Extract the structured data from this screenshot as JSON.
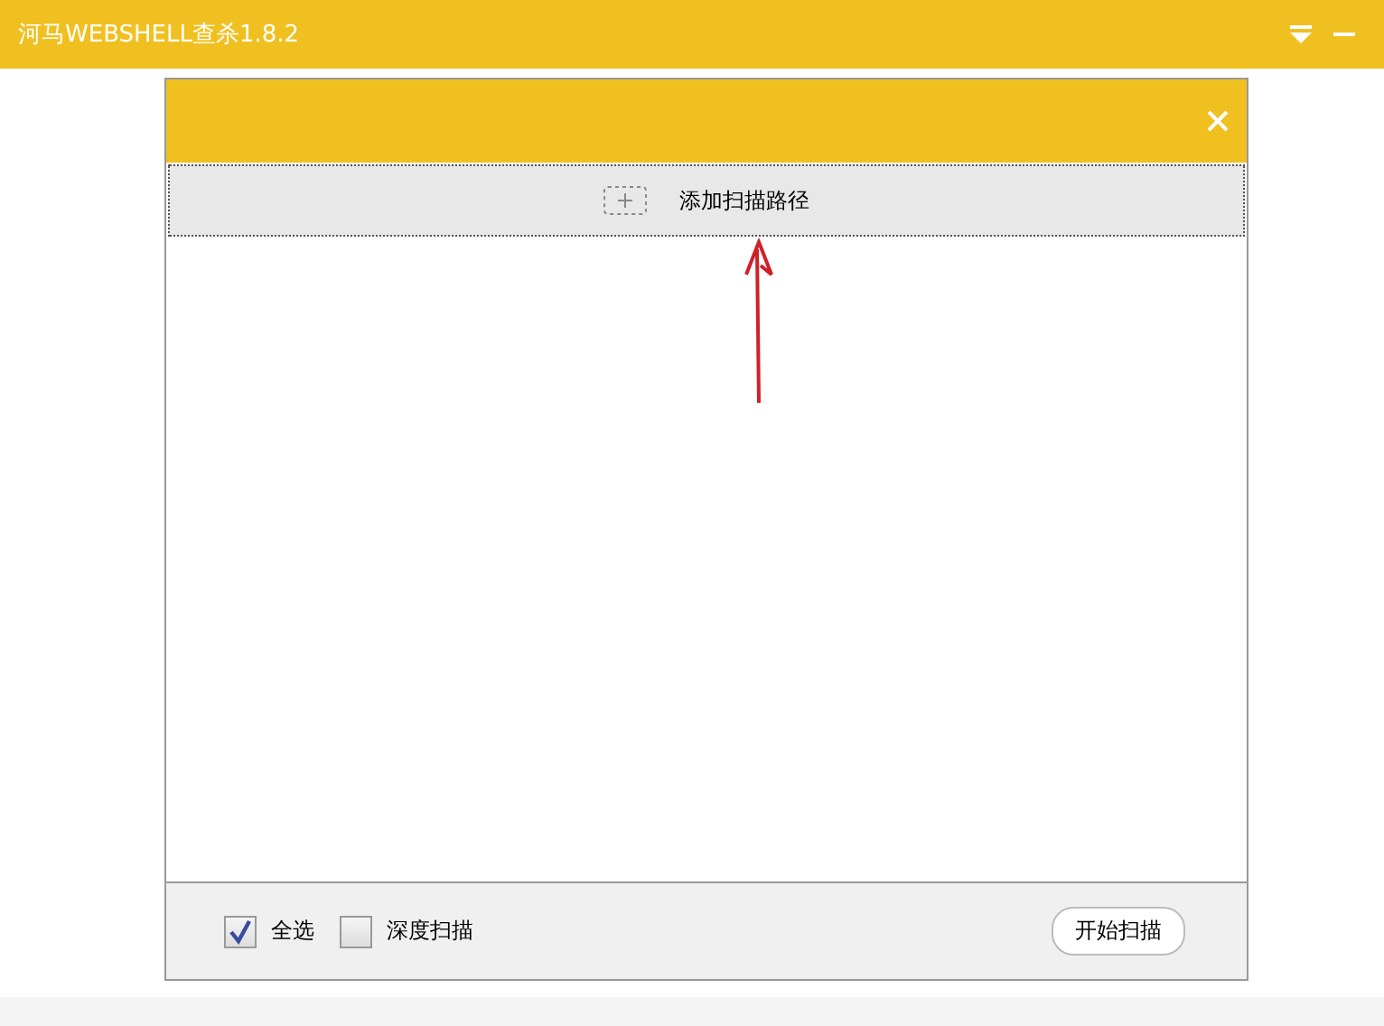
{
  "window": {
    "title": "河马WEBSHELL查杀1.8.2"
  },
  "dialog": {
    "add_path": {
      "label": "添加扫描路径"
    },
    "options": [
      {
        "label": "全选",
        "checked": true
      },
      {
        "label": "深度扫描",
        "checked": false
      }
    ],
    "start_button": {
      "label": "开始扫描"
    }
  }
}
